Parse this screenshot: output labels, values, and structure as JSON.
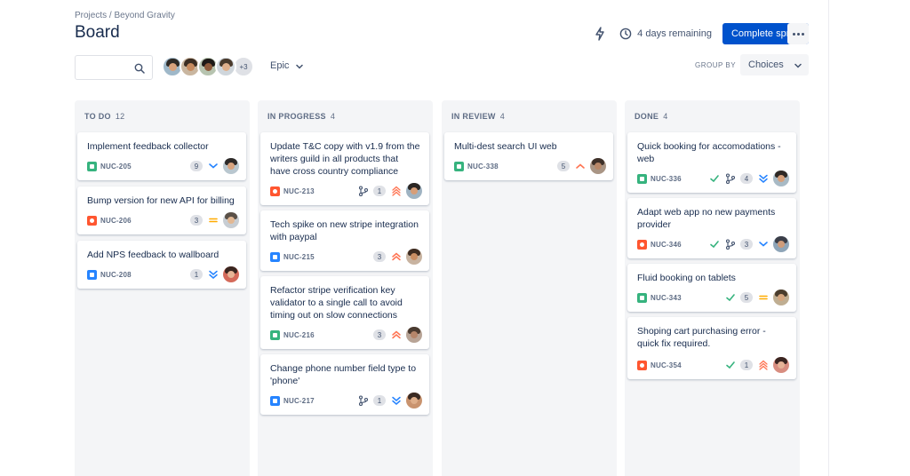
{
  "header": {
    "breadcrumb": "Projects / Beyond Gravity",
    "title": "Board",
    "remaining": "4 days remaining",
    "complete_sprint": "Complete sprint"
  },
  "toolbar": {
    "search_placeholder": "",
    "avatars_more": "+3",
    "epic_label": "Epic",
    "group_by_label": "GROUP BY",
    "group_by_value": "Choices"
  },
  "colors": {
    "accent": "#0052cc",
    "story": "#36b37e",
    "bug": "#ff5630",
    "task": "#2684ff",
    "priority_high": "#ff7452",
    "priority_low": "#2684ff",
    "priority_medium": "#ffab00"
  },
  "columns": [
    {
      "name": "TO DO",
      "count": "12",
      "cards": [
        {
          "title": "Implement feedback collector",
          "key": "NUC-205",
          "type": "story",
          "points": "9",
          "priority": "low"
        },
        {
          "title": "Bump version for new API for billing",
          "key": "NUC-206",
          "type": "bug",
          "points": "3",
          "priority": "medium"
        },
        {
          "title": "Add NPS feedback to wallboard",
          "key": "NUC-208",
          "type": "task",
          "points": "1",
          "priority": "lowest"
        }
      ]
    },
    {
      "name": "IN PROGRESS",
      "count": "4",
      "cards": [
        {
          "title": "Update T&C copy with v1.9 from the writers guild in all products that have cross country compliance",
          "key": "NUC-213",
          "type": "bug",
          "points": "1",
          "priority": "highest",
          "branch": true
        },
        {
          "title": "Tech spike on new stripe integration with paypal",
          "key": "NUC-215",
          "type": "task",
          "points": "3",
          "priority": "high"
        },
        {
          "title": "Refactor stripe verification key validator to a single call to avoid timing out on slow connections",
          "key": "NUC-216",
          "type": "story",
          "points": "3",
          "priority": "high"
        },
        {
          "title": "Change phone number field type to 'phone'",
          "key": "NUC-217",
          "type": "task",
          "points": "1",
          "priority": "lowest",
          "branch": true
        }
      ]
    },
    {
      "name": "IN REVIEW",
      "count": "4",
      "cards": [
        {
          "title": "Multi-dest search UI web",
          "key": "NUC-338",
          "type": "story",
          "points": "5",
          "priority": "medium-high"
        }
      ]
    },
    {
      "name": "DONE",
      "count": "4",
      "cards": [
        {
          "title": "Quick booking for accomodations - web",
          "key": "NUC-336",
          "type": "story",
          "points": "4",
          "priority": "lowest",
          "done": true,
          "branch": true
        },
        {
          "title": "Adapt web app no new payments provider",
          "key": "NUC-346",
          "type": "bug",
          "points": "3",
          "priority": "low",
          "done": true,
          "branch": true
        },
        {
          "title": "Fluid booking on tablets",
          "key": "NUC-343",
          "type": "story",
          "points": "5",
          "priority": "medium",
          "done": true
        },
        {
          "title": "Shoping cart purchasing error - quick fix required.",
          "key": "NUC-354",
          "type": "bug",
          "points": "1",
          "priority": "highest",
          "done": true
        }
      ]
    }
  ]
}
